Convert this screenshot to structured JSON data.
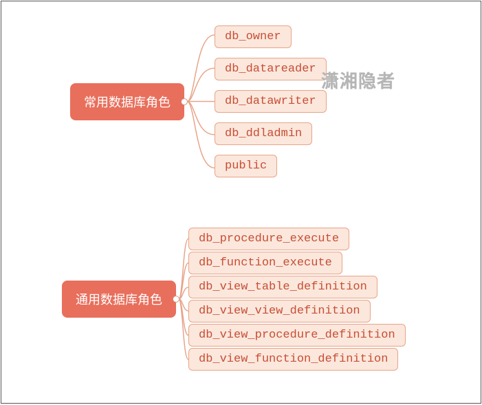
{
  "watermark": "潇湘隐者",
  "colors": {
    "root_bg": "#e86f5c",
    "root_fg": "#ffffff",
    "child_bg": "#fbe7dc",
    "child_border": "#e8a489",
    "child_fg": "#c84e35",
    "connector": "#e8a489"
  },
  "groups": [
    {
      "id": "common-db-roles",
      "title": "常用数据库角色",
      "layout": "spaced",
      "children": [
        "db_owner",
        "db_datareader",
        "db_datawriter",
        "db_ddladmin",
        "public"
      ]
    },
    {
      "id": "general-db-roles",
      "title": "通用数据库角色",
      "layout": "tight",
      "children": [
        "db_procedure_execute",
        "db_function_execute",
        "db_view_table_definition",
        "db_view_view_definition",
        "db_view_procedure_definition",
        "db_view_function_definition"
      ]
    }
  ]
}
